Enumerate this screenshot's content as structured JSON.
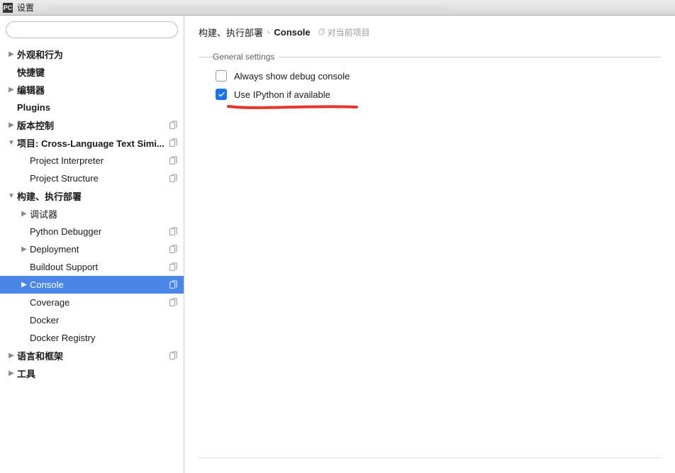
{
  "titlebar": {
    "icon_text": "PC",
    "title": "设置"
  },
  "sidebar": {
    "search_placeholder": "",
    "items": [
      {
        "label": "外观和行为",
        "indent": 0,
        "chevron": "right",
        "bold": true,
        "copy": false,
        "selected": false
      },
      {
        "label": "快捷键",
        "indent": 0,
        "chevron": "",
        "bold": true,
        "copy": false,
        "selected": false
      },
      {
        "label": "编辑器",
        "indent": 0,
        "chevron": "right",
        "bold": true,
        "copy": false,
        "selected": false
      },
      {
        "label": "Plugins",
        "indent": 0,
        "chevron": "",
        "bold": true,
        "copy": false,
        "selected": false
      },
      {
        "label": "版本控制",
        "indent": 0,
        "chevron": "right",
        "bold": true,
        "copy": true,
        "selected": false
      },
      {
        "label": "项目: Cross-Language Text Simi...",
        "indent": 0,
        "chevron": "down",
        "bold": true,
        "copy": true,
        "selected": false
      },
      {
        "label": "Project Interpreter",
        "indent": 1,
        "chevron": "",
        "bold": false,
        "copy": true,
        "selected": false
      },
      {
        "label": "Project Structure",
        "indent": 1,
        "chevron": "",
        "bold": false,
        "copy": true,
        "selected": false
      },
      {
        "label": "构建、执行部署",
        "indent": 0,
        "chevron": "down",
        "bold": true,
        "copy": false,
        "selected": false
      },
      {
        "label": "调试器",
        "indent": 1,
        "chevron": "right",
        "bold": false,
        "copy": false,
        "selected": false
      },
      {
        "label": "Python Debugger",
        "indent": 1,
        "chevron": "",
        "bold": false,
        "copy": true,
        "selected": false
      },
      {
        "label": "Deployment",
        "indent": 1,
        "chevron": "right",
        "bold": false,
        "copy": true,
        "selected": false
      },
      {
        "label": "Buildout Support",
        "indent": 1,
        "chevron": "",
        "bold": false,
        "copy": true,
        "selected": false
      },
      {
        "label": "Console",
        "indent": 1,
        "chevron": "right",
        "bold": false,
        "copy": true,
        "selected": true
      },
      {
        "label": "Coverage",
        "indent": 1,
        "chevron": "",
        "bold": false,
        "copy": true,
        "selected": false
      },
      {
        "label": "Docker",
        "indent": 1,
        "chevron": "",
        "bold": false,
        "copy": false,
        "selected": false
      },
      {
        "label": "Docker Registry",
        "indent": 1,
        "chevron": "",
        "bold": false,
        "copy": false,
        "selected": false
      },
      {
        "label": "语言和框架",
        "indent": 0,
        "chevron": "right",
        "bold": true,
        "copy": true,
        "selected": false
      },
      {
        "label": "工具",
        "indent": 0,
        "chevron": "right",
        "bold": true,
        "copy": false,
        "selected": false
      }
    ]
  },
  "breadcrumb": {
    "parent": "构建、执行部署",
    "current": "Console",
    "scope": "对当前项目"
  },
  "settings": {
    "group_title": "General settings",
    "always_show_debug": {
      "label": "Always show debug console",
      "checked": false
    },
    "use_ipython": {
      "label": "Use IPython if available",
      "checked": true
    }
  }
}
